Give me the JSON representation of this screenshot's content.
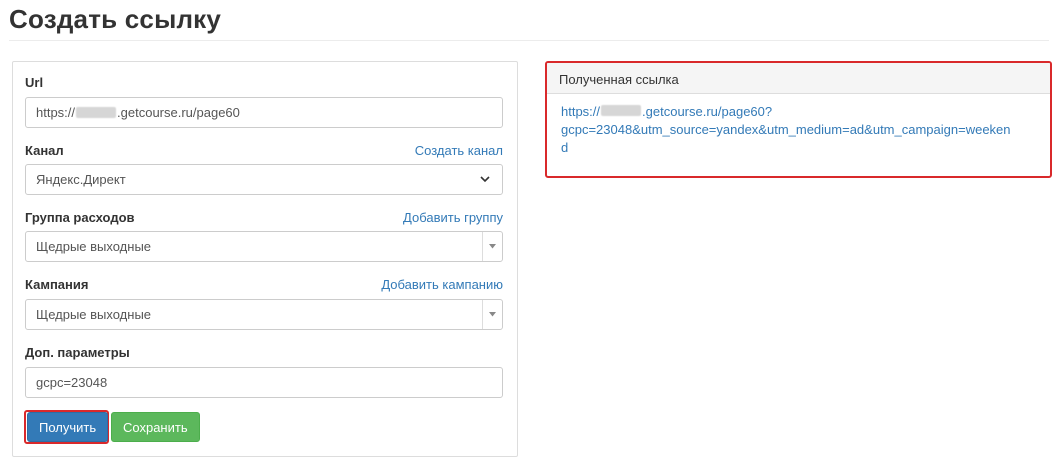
{
  "page": {
    "title": "Создать ссылку"
  },
  "form": {
    "url": {
      "label": "Url",
      "value_prefix": "https://",
      "value_suffix": ".getcourse.ru/page60"
    },
    "channel": {
      "label": "Канал",
      "link": "Создать канал",
      "selected": "Яндекс.Директ"
    },
    "expense_group": {
      "label": "Группа расходов",
      "link": "Добавить группу",
      "selected": "Щедрые выходные"
    },
    "campaign": {
      "label": "Кампания",
      "link": "Добавить кампанию",
      "selected": "Щедрые выходные"
    },
    "extra_params": {
      "label": "Доп. параметры",
      "value": "gcpc=23048"
    },
    "buttons": {
      "get": "Получить",
      "save": "Сохранить"
    }
  },
  "result": {
    "header": "Полученная ссылка",
    "link_prefix": "https://",
    "link_line1_suffix": ".getcourse.ru/page60?",
    "link_line2": "gcpc=23048&utm_source=yandex&utm_medium=ad&utm_campaign=weeken",
    "link_line3": "d"
  },
  "colors": {
    "link": "#337ab7",
    "primary": "#337ab7",
    "success": "#5cb85c",
    "highlight": "#d9292b"
  }
}
